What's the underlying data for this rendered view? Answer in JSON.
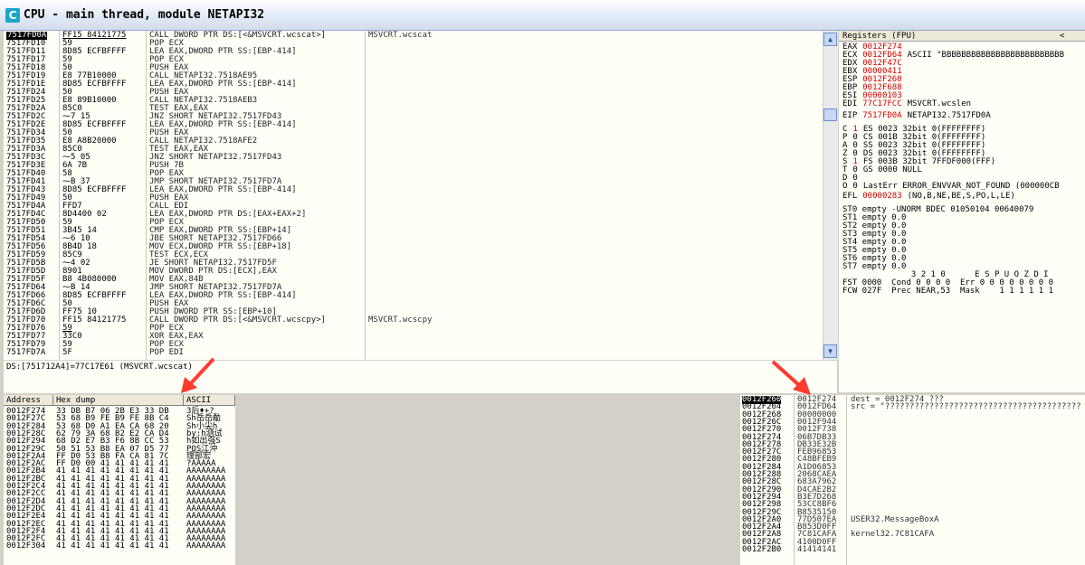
{
  "window": {
    "title": "CPU - main thread, module NETAPI32",
    "icon_letter": "C"
  },
  "disassembly": {
    "rows": [
      {
        "addr": "7517FD0A",
        "hex": "FF15 84121775",
        "cmd": "CALL DWORD PTR DS:[<&MSVCRT.wcscat>]",
        "cmt": "MSVCRT.wcscat",
        "sel": true
      },
      {
        "addr": "7517FD10",
        "hex": "59",
        "cmd": "POP ECX",
        "cmt": ""
      },
      {
        "addr": "7517FD11",
        "hex": "8D85 ECFBFFFF",
        "cmd": "LEA EAX,DWORD PTR SS:[EBP-414]",
        "cmt": ""
      },
      {
        "addr": "7517FD17",
        "hex": "59",
        "cmd": "POP ECX",
        "cmt": ""
      },
      {
        "addr": "7517FD18",
        "hex": "50",
        "cmd": "PUSH EAX",
        "cmt": ""
      },
      {
        "addr": "7517FD19",
        "hex": "E8 77B10000",
        "cmd": "CALL NETAPI32.7518AE95",
        "cmt": ""
      },
      {
        "addr": "7517FD1E",
        "hex": "8D85 ECFBFFFF",
        "cmd": "LEA EAX,DWORD PTR SS:[EBP-414]",
        "cmt": ""
      },
      {
        "addr": "7517FD24",
        "hex": "50",
        "cmd": "PUSH EAX",
        "cmt": ""
      },
      {
        "addr": "7517FD25",
        "hex": "E8 89B10000",
        "cmd": "CALL NETAPI32.7518AEB3",
        "cmt": ""
      },
      {
        "addr": "7517FD2A",
        "hex": "85C0",
        "cmd": "TEST EAX,EAX",
        "cmt": ""
      },
      {
        "addr": "7517FD2C",
        "hex": "⁓7 15",
        "cmd": "JNZ SHORT NETAPI32.7517FD43",
        "cmt": ""
      },
      {
        "addr": "7517FD2E",
        "hex": "8D85 ECFBFFFF",
        "cmd": "LEA EAX,DWORD PTR SS:[EBP-414]",
        "cmt": ""
      },
      {
        "addr": "7517FD34",
        "hex": "50",
        "cmd": "PUSH EAX",
        "cmt": ""
      },
      {
        "addr": "7517FD35",
        "hex": "E8 A8B20000",
        "cmd": "CALL NETAPI32.7518AFE2",
        "cmt": ""
      },
      {
        "addr": "7517FD3A",
        "hex": "85C0",
        "cmd": "TEST EAX,EAX",
        "cmt": ""
      },
      {
        "addr": "7517FD3C",
        "hex": "⁓5 05",
        "cmd": "JNZ SHORT NETAPI32.7517FD43",
        "cmt": ""
      },
      {
        "addr": "7517FD3E",
        "hex": "6A 7B",
        "cmd": "PUSH 7B",
        "cmt": ""
      },
      {
        "addr": "7517FD40",
        "hex": "58",
        "cmd": "POP EAX",
        "cmt": ""
      },
      {
        "addr": "7517FD41",
        "hex": "⁓B 37",
        "cmd": "JMP SHORT NETAPI32.7517FD7A",
        "cmt": ""
      },
      {
        "addr": "7517FD43",
        "hex": "8D85 ECFBFFFF",
        "cmd": "LEA EAX,DWORD PTR SS:[EBP-414]",
        "cmt": ""
      },
      {
        "addr": "7517FD49",
        "hex": "50",
        "cmd": "PUSH EAX",
        "cmt": ""
      },
      {
        "addr": "7517FD4A",
        "hex": "FFD7",
        "cmd": "CALL EDI",
        "cmt": ""
      },
      {
        "addr": "7517FD4C",
        "hex": "8D4400 02",
        "cmd": "LEA EAX,DWORD PTR DS:[EAX+EAX+2]",
        "cmt": ""
      },
      {
        "addr": "7517FD50",
        "hex": "59",
        "cmd": "POP ECX",
        "cmt": ""
      },
      {
        "addr": "7517FD51",
        "hex": "3B45 14",
        "cmd": "CMP EAX,DWORD PTR SS:[EBP+14]",
        "cmt": ""
      },
      {
        "addr": "7517FD54",
        "hex": "⁓6 10",
        "cmd": "JBE SHORT NETAPI32.7517FD66",
        "cmt": ""
      },
      {
        "addr": "7517FD56",
        "hex": "8B4D 18",
        "cmd": "MOV ECX,DWORD PTR SS:[EBP+18]",
        "cmt": ""
      },
      {
        "addr": "7517FD59",
        "hex": "85C9",
        "cmd": "TEST ECX,ECX",
        "cmt": ""
      },
      {
        "addr": "7517FD5B",
        "hex": "⁓4 02",
        "cmd": "JE SHORT NETAPI32.7517FD5F",
        "cmt": ""
      },
      {
        "addr": "7517FD5D",
        "hex": "8901",
        "cmd": "MOV DWORD PTR DS:[ECX],EAX",
        "cmt": ""
      },
      {
        "addr": "7517FD5F",
        "hex": "B8 4B080000",
        "cmd": "MOV EAX,84B",
        "cmt": ""
      },
      {
        "addr": "7517FD64",
        "hex": "⁓B 14",
        "cmd": "JMP SHORT NETAPI32.7517FD7A",
        "cmt": ""
      },
      {
        "addr": "7517FD66",
        "hex": "8D85 ECFBFFFF",
        "cmd": "LEA EAX,DWORD PTR SS:[EBP-414]",
        "cmt": ""
      },
      {
        "addr": "7517FD6C",
        "hex": "50",
        "cmd": "PUSH EAX",
        "cmt": ""
      },
      {
        "addr": "7517FD6D",
        "hex": "FF75 10",
        "cmd": "PUSH DWORD PTR SS:[EBP+10]",
        "cmt": ""
      },
      {
        "addr": "7517FD70",
        "hex": "FF15 84121775",
        "cmd": "CALL DWORD PTR DS:[<&MSVCRT.wcscpy>]",
        "cmt": "MSVCRT.wcscpy"
      },
      {
        "addr": "7517FD76",
        "hex": "59",
        "cmd": "POP ECX",
        "cmt": ""
      },
      {
        "addr": "7517FD77",
        "hex": "33C0",
        "cmd": "XOR EAX,EAX",
        "cmt": ""
      },
      {
        "addr": "7517FD79",
        "hex": "59",
        "cmd": "POP ECX",
        "cmt": ""
      },
      {
        "addr": "7517FD7A",
        "hex": "5F",
        "cmd": "POP EDI",
        "cmt": ""
      }
    ]
  },
  "info_line": "DS:[751712A4]=77C17E61 (MSVCRT.wcscat)",
  "registers": {
    "header": "Registers (FPU)",
    "header_arrow": "<",
    "lines": [
      {
        "name": "EAX",
        "value": "0012F274",
        "note": ""
      },
      {
        "name": "ECX",
        "value": "0012FD64",
        "note": "ASCII \"BBBBBBBBBBBBBBBBBBBBBBBBB"
      },
      {
        "name": "EDX",
        "value": "0012F47C",
        "note": ""
      },
      {
        "name": "EBX",
        "value": "00000411",
        "note": ""
      },
      {
        "name": "ESP",
        "value": "0012F260",
        "note": ""
      },
      {
        "name": "EBP",
        "value": "0012F688",
        "note": ""
      },
      {
        "name": "ESI",
        "value": "00000103",
        "note": ""
      },
      {
        "name": "EDI",
        "value": "77C17FCC",
        "note": "MSVCRT.wcslen"
      },
      {
        "name": "",
        "value": "",
        "note": ""
      },
      {
        "name": "EIP",
        "value": "7517FD0A",
        "note": "NETAPI32.7517FD0A"
      }
    ],
    "flags": [
      {
        "f": "C",
        "v": "1",
        "seg": "ES 0023 32bit 0(FFFFFFFF)"
      },
      {
        "f": "P",
        "v": "0",
        "seg": "CS 001B 32bit 0(FFFFFFFF)"
      },
      {
        "f": "A",
        "v": "0",
        "seg": "SS 0023 32bit 0(FFFFFFFF)"
      },
      {
        "f": "Z",
        "v": "0",
        "seg": "DS 0023 32bit 0(FFFFFFFF)"
      },
      {
        "f": "S",
        "v": "1",
        "seg": "FS 003B 32bit 7FFDF000(FFF)"
      },
      {
        "f": "T",
        "v": "0",
        "seg": "GS 0000 NULL"
      },
      {
        "f": "D",
        "v": "0",
        "seg": ""
      },
      {
        "f": "O",
        "v": "0",
        "seg": "LastErr ERROR_ENVVAR_NOT_FOUND (000000CB"
      }
    ],
    "efl": "EFL",
    "efl_value": "00000283",
    "efl_note": "(NO,B,NE,BE,S,PO,L,LE)",
    "fpu": [
      "ST0 empty -UNORM BDEC 01050104 00640079",
      "ST1 empty 0.0",
      "ST2 empty 0.0",
      "ST3 empty 0.0",
      "ST4 empty 0.0",
      "ST5 empty 0.0",
      "ST6 empty 0.0",
      "ST7 empty 0.0"
    ],
    "fst_bits": "              3 2 1 0      E S P U O Z D I",
    "fst": "FST 0000  Cond 0 0 0 0  Err 0 0 0 0 0 0 0 0",
    "fcw": "FCW 027F  Prec NEAR,53  Mask    1 1 1 1 1 1"
  },
  "dump": {
    "headers": [
      "Address",
      "Hex dump",
      "ASCII"
    ],
    "rows": [
      {
        "addr": "0012F274",
        "hex": "33 DB B7 06 2B E3 33 DB",
        "ascii": "3后♦+?"
      },
      {
        "addr": "0012F27C",
        "hex": "53 68 B9 FE B9 FE 8B C4",
        "ascii": "Sh岳岳勈"
      },
      {
        "addr": "0012F284",
        "hex": "53 68 D0 A1 EA CA 68 20",
        "ascii": "Sh小尖h"
      },
      {
        "addr": "0012F28C",
        "hex": "62 79 3A 68 B2 E2 CA D4",
        "ascii": "by:h测试"
      },
      {
        "addr": "0012F294",
        "hex": "68 D2 E7 B3 F6 8B CC 53",
        "ascii": "h如出强S"
      },
      {
        "addr": "0012F29C",
        "hex": "50 51 53 B8 EA 07 D5 77",
        "ascii": "PQS江‪沖"
      },
      {
        "addr": "0012F2A4",
        "hex": "FF D0 53 B8 FA CA 81 7C",
        "ascii": " 理部宏"
      },
      {
        "addr": "0012F2AC",
        "hex": "FF D0 00 41 41 41 41 41",
        "ascii": " ?AAAAA"
      },
      {
        "addr": "0012F2B4",
        "hex": "41 41 41 41 41 41 41 41",
        "ascii": "AAAAAAAA"
      },
      {
        "addr": "0012F2BC",
        "hex": "41 41 41 41 41 41 41 41",
        "ascii": "AAAAAAAA"
      },
      {
        "addr": "0012F2C4",
        "hex": "41 41 41 41 41 41 41 41",
        "ascii": "AAAAAAAA"
      },
      {
        "addr": "0012F2CC",
        "hex": "41 41 41 41 41 41 41 41",
        "ascii": "AAAAAAAA"
      },
      {
        "addr": "0012F2D4",
        "hex": "41 41 41 41 41 41 41 41",
        "ascii": "AAAAAAAA"
      },
      {
        "addr": "0012F2DC",
        "hex": "41 41 41 41 41 41 41 41",
        "ascii": "AAAAAAAA"
      },
      {
        "addr": "0012F2E4",
        "hex": "41 41 41 41 41 41 41 41",
        "ascii": "AAAAAAAA"
      },
      {
        "addr": "0012F2EC",
        "hex": "41 41 41 41 41 41 41 41",
        "ascii": "AAAAAAAA"
      },
      {
        "addr": "0012F2F4",
        "hex": "41 41 41 41 41 41 41 41",
        "ascii": "AAAAAAAA"
      },
      {
        "addr": "0012F2FC",
        "hex": "41 41 41 41 41 41 41 41",
        "ascii": "AAAAAAAA"
      },
      {
        "addr": "0012F304",
        "hex": "41 41 41 41 41 41 41 41",
        "ascii": "AAAAAAAA"
      }
    ]
  },
  "stack": {
    "rows": [
      {
        "addr": "0012F260",
        "val": "0012F274",
        "cmt": "dest = 0012F274 ???",
        "sel": true
      },
      {
        "addr": "0012F264",
        "val": "0012FD64",
        "cmt": "src = \"????????????????????????????????????????"
      },
      {
        "addr": "0012F268",
        "val": "00000000",
        "cmt": ""
      },
      {
        "addr": "0012F26C",
        "val": "0012F944",
        "cmt": ""
      },
      {
        "addr": "0012F270",
        "val": "0012F738",
        "cmt": ""
      },
      {
        "addr": "0012F274",
        "val": "06B7DB33",
        "cmt": ""
      },
      {
        "addr": "0012F278",
        "val": "DB33E32B",
        "cmt": ""
      },
      {
        "addr": "0012F27C",
        "val": "FEB96853",
        "cmt": ""
      },
      {
        "addr": "0012F280",
        "val": "C48BFEB9",
        "cmt": ""
      },
      {
        "addr": "0012F284",
        "val": "A1D06853",
        "cmt": ""
      },
      {
        "addr": "0012F288",
        "val": "2068CAEA",
        "cmt": ""
      },
      {
        "addr": "0012F28C",
        "val": "683A7962",
        "cmt": ""
      },
      {
        "addr": "0012F290",
        "val": "D4CAE2B2",
        "cmt": ""
      },
      {
        "addr": "0012F294",
        "val": "B3E7D268",
        "cmt": ""
      },
      {
        "addr": "0012F298",
        "val": "53CC8BF6",
        "cmt": ""
      },
      {
        "addr": "0012F29C",
        "val": "B8535150",
        "cmt": ""
      },
      {
        "addr": "0012F2A0",
        "val": "77D507EA",
        "cmt": "USER32.MessageBoxA"
      },
      {
        "addr": "0012F2A4",
        "val": "B853D0FF",
        "cmt": ""
      },
      {
        "addr": "0012F2A8",
        "val": "7C81CAFA",
        "cmt": "kernel32.7C81CAFA"
      },
      {
        "addr": "0012F2AC",
        "val": "4100D0FF",
        "cmt": ""
      },
      {
        "addr": "0012F2B0",
        "val": "41414141",
        "cmt": ""
      }
    ]
  },
  "colors": {
    "accent_red": "#d00000",
    "arrow_red": "#ff3b30",
    "pane_bg": "#fffff8",
    "selection": "#000000"
  }
}
